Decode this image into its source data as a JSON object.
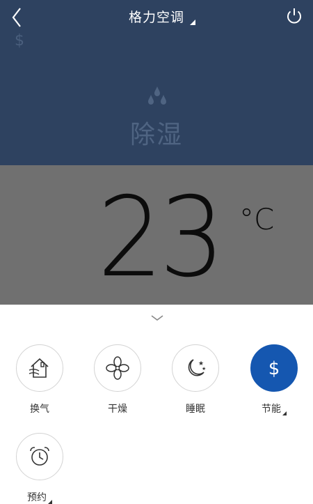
{
  "header": {
    "title": "格力空调",
    "back_icon": "back-chevron-icon",
    "power_icon": "power-icon"
  },
  "status": {
    "eco_indicator": "$",
    "mode_icon": "water-drops-icon",
    "mode_label": "除湿",
    "temperature": "23",
    "unit": "°C"
  },
  "functions": [
    {
      "id": "ventilation",
      "label": "换气",
      "icon": "house-air-icon",
      "active": false
    },
    {
      "id": "dry",
      "label": "干燥",
      "icon": "fan-icon",
      "active": false
    },
    {
      "id": "sleep",
      "label": "睡眠",
      "icon": "moon-stars-icon",
      "active": false
    },
    {
      "id": "energy",
      "label": "节能",
      "icon": "dollar-icon",
      "active": true
    },
    {
      "id": "schedule",
      "label": "预约",
      "icon": "alarm-clock-icon",
      "active": false
    }
  ],
  "colors": {
    "header_bg": "#2e4260",
    "temp_bg": "#707070",
    "active_blue": "#1557b0"
  }
}
